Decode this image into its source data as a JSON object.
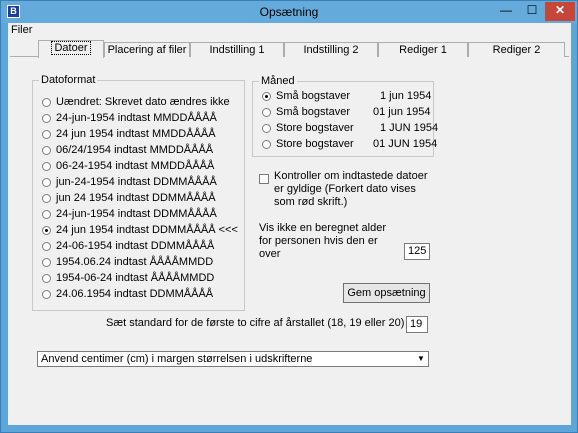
{
  "window": {
    "title": "Opsætning",
    "app_icon_glyph": "B"
  },
  "titlebar": {
    "minimize": "—",
    "maximize": "☐",
    "close": "✕"
  },
  "menu": {
    "filer": "Filer"
  },
  "tabs": [
    {
      "label": "Datoer",
      "active": true
    },
    {
      "label": "Placering af filer"
    },
    {
      "label": "Indstilling 1"
    },
    {
      "label": "Indstilling 2"
    },
    {
      "label": "Rediger 1"
    },
    {
      "label": "Rediger 2"
    }
  ],
  "datoformat": {
    "title": "Datoformat",
    "options": [
      {
        "label": "Uændret: Skrevet dato ændres ikke",
        "checked": false
      },
      {
        "label": "24-jun-1954 indtast MMDDÅÅÅÅ",
        "checked": false
      },
      {
        "label": "24 jun 1954 indtast MMDDÅÅÅÅ",
        "checked": false
      },
      {
        "label": "06/24/1954 indtast MMDDÅÅÅÅ",
        "checked": false
      },
      {
        "label": "06-24-1954 indtast MMDDÅÅÅÅ",
        "checked": false
      },
      {
        "label": "jun-24-1954 indtast DDMMÅÅÅÅ",
        "checked": false
      },
      {
        "label": "jun 24 1954 indtast DDMMÅÅÅÅ",
        "checked": false
      },
      {
        "label": "24-jun-1954 indtast DDMMÅÅÅÅ",
        "checked": false
      },
      {
        "label": "24 jun 1954 indtast DDMMÅÅÅÅ <<<",
        "checked": true
      },
      {
        "label": "24-06-1954 indtast DDMMÅÅÅÅ",
        "checked": false
      },
      {
        "label": "1954.06.24 indtast ÅÅÅÅMMDD",
        "checked": false
      },
      {
        "label": "1954-06-24 indtast ÅÅÅÅMMDD",
        "checked": false
      },
      {
        "label": "24.06.1954 indtast DDMMÅÅÅÅ",
        "checked": false
      }
    ]
  },
  "maaned": {
    "title": "Måned",
    "options": [
      {
        "label": "Små bogstaver",
        "example": "1 jun 1954",
        "checked": true
      },
      {
        "label": "Små bogstaver",
        "example": "01 jun 1954",
        "checked": false
      },
      {
        "label": "Store bogstaver",
        "example": "1 JUN 1954",
        "checked": false
      },
      {
        "label": "Store bogstaver",
        "example": "01 JUN 1954",
        "checked": false
      }
    ]
  },
  "kontroller": {
    "line1": "Kontroller om indtastede datoer",
    "line2": "er gyldige (Forkert dato vises",
    "line3": "som rød skrift.)",
    "checked": false
  },
  "alder": {
    "line1": "Vis ikke en beregnet alder",
    "line2": "for personen hvis den er",
    "line3": "over",
    "value": "125"
  },
  "gem_button": "Gem opsætning",
  "aarstal": {
    "label": "Sæt standard for de første to cifre af årstallet (18, 19 eller 20)",
    "value": "19"
  },
  "margin_combo": {
    "value": "Anvend centimer (cm) i margen størrelsen i udskrifterne",
    "arrow_icon": "dropdown-arrow"
  }
}
